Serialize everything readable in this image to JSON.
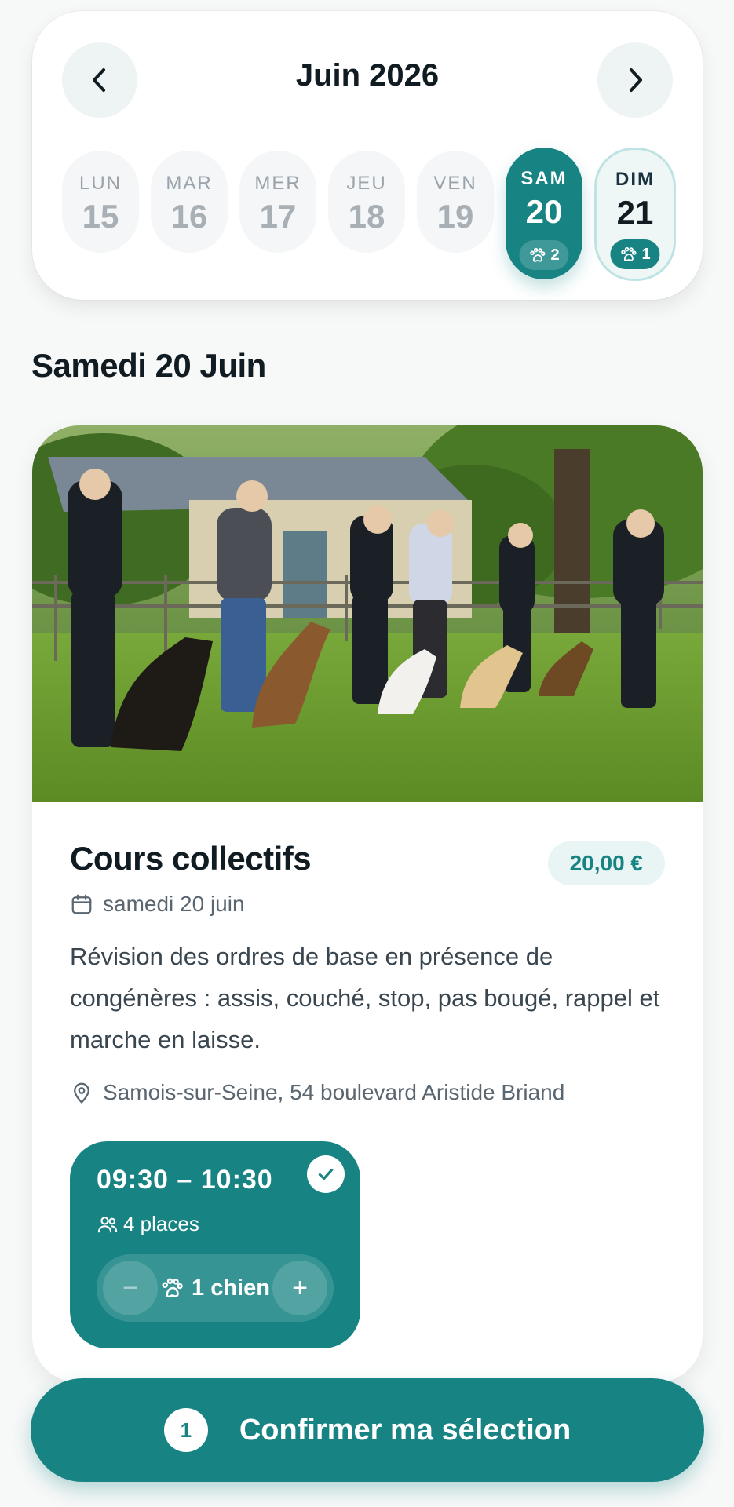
{
  "calendar": {
    "month_title": "Juin 2026",
    "prev_icon": "chevron-left-icon",
    "next_icon": "chevron-right-icon",
    "days": [
      {
        "name": "LUN",
        "num": "15",
        "state": "disabled",
        "count": ""
      },
      {
        "name": "MAR",
        "num": "16",
        "state": "disabled",
        "count": ""
      },
      {
        "name": "MER",
        "num": "17",
        "state": "disabled",
        "count": ""
      },
      {
        "name": "JEU",
        "num": "18",
        "state": "disabled",
        "count": ""
      },
      {
        "name": "VEN",
        "num": "19",
        "state": "disabled",
        "count": ""
      },
      {
        "name": "SAM",
        "num": "20",
        "state": "selected",
        "count": "2"
      },
      {
        "name": "DIM",
        "num": "21",
        "state": "available",
        "count": "1"
      }
    ]
  },
  "section_title": "Samedi 20 Juin",
  "course": {
    "title": "Cours collectifs",
    "price": "20,00 €",
    "date": "samedi 20 juin",
    "description": "Révision des ordres de base en présence de congénères : assis, couché, stop, pas bougé, rappel et marche en laisse.",
    "location": "Samois-sur-Seine, 54 boulevard Aristide Briand",
    "slot": {
      "time": "09:30 – 10:30",
      "places": "4 places",
      "dogs": "1 chien",
      "selected": true
    }
  },
  "confirm": {
    "count": "1",
    "label": "Confirmer ma sélection"
  },
  "colors": {
    "accent": "#178383",
    "accent_light": "#e9f4f4",
    "text": "#111b22"
  }
}
